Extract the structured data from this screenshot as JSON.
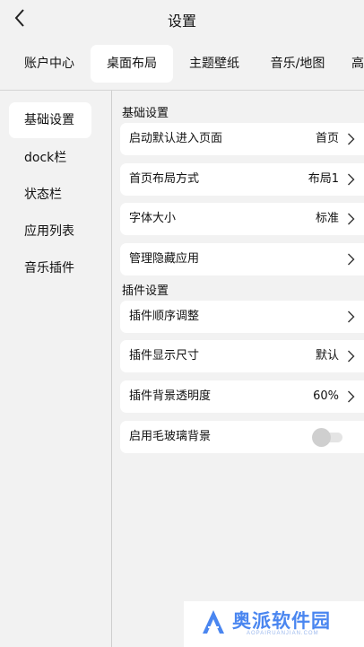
{
  "header": {
    "title": "设置"
  },
  "tabs": [
    {
      "label": "账户中心",
      "active": false
    },
    {
      "label": "桌面布局",
      "active": true
    },
    {
      "label": "主题壁纸",
      "active": false
    },
    {
      "label": "音乐/地图",
      "active": false
    },
    {
      "label": "高",
      "active": false
    }
  ],
  "sidebar": {
    "items": [
      {
        "label": "基础设置",
        "active": true
      },
      {
        "label": "dock栏",
        "active": false
      },
      {
        "label": "状态栏",
        "active": false
      },
      {
        "label": "应用列表",
        "active": false
      },
      {
        "label": "音乐插件",
        "active": false
      }
    ]
  },
  "main": {
    "basic_section": {
      "title": "基础设置",
      "rows": [
        {
          "label": "启动默认进入页面",
          "value": "首页"
        },
        {
          "label": "首页布局方式",
          "value": "布局1"
        },
        {
          "label": "字体大小",
          "value": "标准"
        },
        {
          "label": "管理隐藏应用",
          "value": ""
        }
      ]
    },
    "plugin_section": {
      "title": "插件设置",
      "rows": [
        {
          "label": "插件顺序调整",
          "value": ""
        },
        {
          "label": "插件显示尺寸",
          "value": "默认"
        },
        {
          "label": "插件背景透明度",
          "value": "60%"
        }
      ],
      "toggle_row": {
        "label": "启用毛玻璃背景",
        "enabled": false
      }
    }
  },
  "watermark": {
    "text": "奥派软件园",
    "subtext": "AOPAIRUANJIAN.COM"
  },
  "icons": {
    "back": "chevron-left-icon",
    "row_arrow": "chevron-right-icon"
  },
  "colors": {
    "background": "#f2f2f2",
    "card": "#ffffff",
    "watermark": "#4a86f0"
  }
}
